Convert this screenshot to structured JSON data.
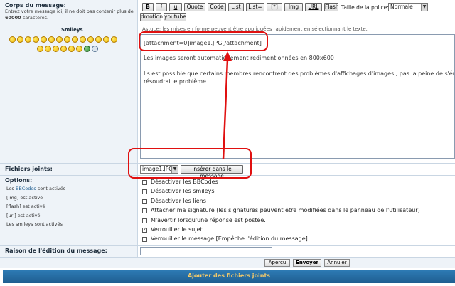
{
  "message_body": {
    "label": "Corps du message:",
    "hint": "Entrez votre message ici, il ne doit pas contenir plus de",
    "hint_limit": "60000",
    "hint_tail": "caractères.",
    "smileys_label": "Smileys"
  },
  "toolbar": {
    "bold": "B",
    "italic": "i",
    "underline": "u",
    "quote": "Quote",
    "code": "Code",
    "list": "List",
    "list_eq": "List=",
    "list_item": "[*]",
    "img": "Img",
    "url": "URL",
    "flash": "Flash",
    "font_size_label": "Taille de la police:",
    "font_size_value": "Normale",
    "dmotion": "dmotion",
    "youtube": "youtube",
    "tip": "Astuce: les mises en forme peuvent être appliquées rapidement en sélectionnant le texte."
  },
  "editor": {
    "line1": "[attachment=0]image1.JPG[/attachment]",
    "line2": "Les images seront automatiquement redimentionnées en 800x600",
    "line3": "Ils est possible que certains membres rencontrent des problèmes d'affichages d'images , pas la peine de s'én",
    "line4": "résoudrai le problème ."
  },
  "attachments": {
    "label": "Fichiers joints:",
    "selected_file": "image1.JPG",
    "insert_button": "Insérer dans le message"
  },
  "options": {
    "label": "Options:",
    "notes": [
      {
        "prefix": "Les ",
        "link": "BBCodes",
        "suffix": " sont activés"
      },
      {
        "prefix": "[img] est activé",
        "link": "",
        "suffix": ""
      },
      {
        "prefix": "[flash] est activé",
        "link": "",
        "suffix": ""
      },
      {
        "prefix": "[url] est activé",
        "link": "",
        "suffix": ""
      },
      {
        "prefix": "Les smileys sont activés",
        "link": "",
        "suffix": ""
      }
    ],
    "items": [
      {
        "label": "Désactiver les BBCodes",
        "checked": false
      },
      {
        "label": "Désactiver les smileys",
        "checked": false
      },
      {
        "label": "Désactiver les liens",
        "checked": false
      },
      {
        "label": "Attacher ma signature (les signatures peuvent être modifiées dans le panneau de l'utilisateur)",
        "checked": false
      },
      {
        "label": "M'avertir lorsqu'une réponse est postée.",
        "checked": false
      },
      {
        "label": "Verrouiller le sujet",
        "checked": true
      },
      {
        "label": "Verrouiller le message [Empêche l'édition du message]",
        "checked": false
      }
    ]
  },
  "edit_reason": {
    "label": "Raison de l'édition du message:",
    "value": ""
  },
  "actions": {
    "preview": "Aperçu",
    "submit": "Envoyer",
    "cancel": "Annuler"
  },
  "bottom_bar": {
    "title": "Ajouter des fichiers joints"
  },
  "colors": {
    "highlight": "#e01010",
    "bar": "#2e7cb6",
    "bar_text": "#f2c96a"
  }
}
